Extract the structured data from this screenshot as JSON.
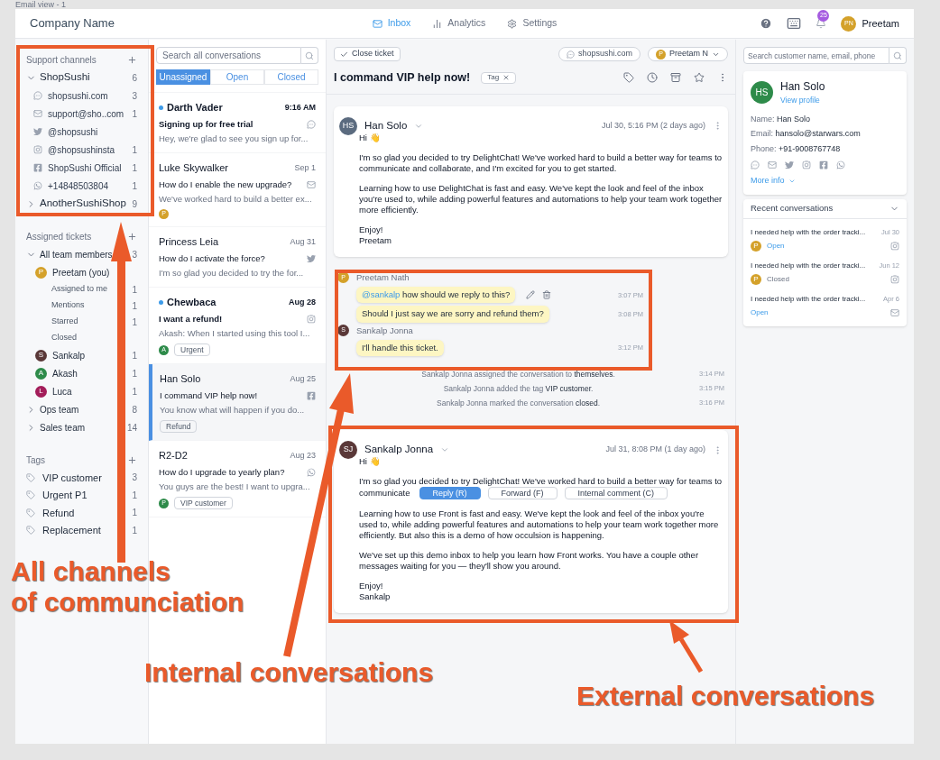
{
  "page_caption": "Email view - 1",
  "header": {
    "company": "Company Name",
    "nav": [
      {
        "label": "Inbox",
        "selected": true
      },
      {
        "label": "Analytics",
        "selected": false
      },
      {
        "label": "Settings",
        "selected": false
      }
    ],
    "notification_count": "25",
    "user": {
      "initials": "PN",
      "name": "Preetam"
    }
  },
  "sidebar": {
    "channels": {
      "title": "Support channels",
      "items": [
        {
          "label": "ShopSushi",
          "count": "6",
          "expanded": true,
          "children": [
            {
              "label": "shopsushi.com",
              "count": "3",
              "kind": "web"
            },
            {
              "label": "support@sho..com",
              "count": "1",
              "kind": "email"
            },
            {
              "label": "@shopsushi",
              "kind": "twitter"
            },
            {
              "label": "@shopsushinsta",
              "count": "1",
              "kind": "instagram"
            },
            {
              "label": "ShopSushi Official",
              "count": "1",
              "kind": "facebook"
            },
            {
              "label": "+14848503804",
              "count": "1",
              "kind": "whatsapp"
            }
          ]
        },
        {
          "label": "AnotherSushiShop",
          "count": "9",
          "expanded": false
        }
      ]
    },
    "assigned": {
      "title": "Assigned tickets",
      "items": [
        {
          "label": "All team members",
          "count": "3",
          "expanded": true,
          "children": [
            {
              "label": "Preetam (you)",
              "initial": "P",
              "color": "#d4a12a",
              "children": [
                {
                  "label": "Assigned to me",
                  "count": "1"
                },
                {
                  "label": "Mentions",
                  "count": "1"
                },
                {
                  "label": "Starred",
                  "count": "1"
                },
                {
                  "label": "Closed"
                }
              ]
            },
            {
              "label": "Sankalp",
              "initial": "S",
              "color": "#5a3838",
              "count": "1"
            },
            {
              "label": "Akash",
              "initial": "A",
              "color": "#2e8b4a",
              "count": "1"
            },
            {
              "label": "Luca",
              "initial": "L",
              "color": "#a31d5a",
              "count": "1"
            }
          ]
        },
        {
          "label": "Ops team",
          "count": "8",
          "expanded": false
        },
        {
          "label": "Sales team",
          "count": "14",
          "expanded": false
        }
      ]
    },
    "tags": {
      "title": "Tags",
      "items": [
        {
          "label": "VIP customer",
          "count": "3"
        },
        {
          "label": "Urgent P1",
          "count": "1"
        },
        {
          "label": "Refund",
          "count": "1"
        },
        {
          "label": "Replacement",
          "count": "1"
        }
      ]
    }
  },
  "conversations": {
    "search_placeholder": "Search all conversations",
    "filters": [
      {
        "label": "Unassigned",
        "selected": true
      },
      {
        "label": "Open",
        "selected": false
      },
      {
        "label": "Closed",
        "selected": false
      }
    ],
    "items": [
      {
        "name": "Darth Vader",
        "unread": true,
        "selected": false,
        "time": "9:16 AM",
        "subject": "Signing up for free trial",
        "preview": "Hey, we're glad to see you sign up for...",
        "kind": "web"
      },
      {
        "name": "Luke Skywalker",
        "unread": false,
        "selected": false,
        "time": "Sep 1",
        "subject": "How do I enable the new upgrade?",
        "preview": "We've worked hard to build a better ex...",
        "kind": "email",
        "assignee": {
          "initial": "P",
          "color": "#d4a12a"
        }
      },
      {
        "name": "Princess Leia",
        "unread": false,
        "selected": false,
        "time": "Aug 31",
        "subject": "How do I activate the force?",
        "preview": "I'm so glad you decided to try the for...",
        "kind": "twitter"
      },
      {
        "name": "Chewbaca",
        "unread": true,
        "selected": false,
        "time": "Aug 28",
        "subject": "I want a refund!",
        "preview": "Akash: When I started using this tool I...",
        "kind": "instagram",
        "assignee": {
          "initial": "A",
          "color": "#2e8b4a"
        },
        "tag": "Urgent"
      },
      {
        "name": "Han Solo",
        "unread": false,
        "selected": true,
        "time": "Aug 25",
        "subject": "I command VIP help now!",
        "preview": "You know what will happen if you do...",
        "kind": "facebook",
        "tag": "Refund"
      },
      {
        "name": "R2-D2",
        "unread": false,
        "selected": false,
        "time": "Aug 23",
        "subject": "How do I upgrade to yearly plan?",
        "preview": "You guys are the best! I want to upgra...",
        "kind": "whatsapp",
        "assignee": {
          "initial": "P",
          "color": "#2e8b4a"
        },
        "tag": "VIP customer"
      }
    ]
  },
  "ticket": {
    "close_button": "Close ticket",
    "channel": "shopsushi.com",
    "assignee": {
      "initial": "P",
      "name": "Preetam N"
    },
    "title": "I command VIP help now!",
    "tag_button": "Tag",
    "thread": [
      {
        "kind": "email",
        "initials": "HS",
        "color": "#5b6b7f",
        "author": "Han Solo",
        "time": "Jul 30, 5:16 PM (2 days ago)",
        "paragraphs": [
          "Hi 👋",
          "I'm so glad you decided to try DelightChat! We've worked hard to build a better way for teams to communicate and collaborate, and I'm excited for you to get started.",
          "Learning how to use DelightChat is fast and easy. We've kept the look and feel of the inbox you're used to, while adding powerful features and automations to help your team work together more efficiently.",
          "Enjoy!\nPreetam"
        ]
      },
      {
        "kind": "notes",
        "groups": [
          {
            "initial": "P",
            "color": "#d4a12a",
            "author": "Preetam Nath",
            "bubbles": [
              {
                "mention": "@sankalp",
                "text": " how should we reply to this?",
                "time": "3:07 PM",
                "editable": true
              },
              {
                "text": "Should I just say we are sorry and refund them?",
                "time": "3:08 PM",
                "editable": false
              }
            ]
          },
          {
            "initial": "S",
            "color": "#5a3838",
            "author": "Sankalp Jonna",
            "bubbles": [
              {
                "text": "I'll handle this ticket.",
                "time": "3:12 PM",
                "editable": false
              }
            ]
          }
        ]
      },
      {
        "kind": "event",
        "text": "Sankalp Jonna assigned the conversation to **themselves**.",
        "time": "3:14 PM"
      },
      {
        "kind": "event",
        "text": "Sankalp Jonna added the tag **VIP customer**.",
        "time": "3:15 PM"
      },
      {
        "kind": "event",
        "text": "Sankalp Jonna marked the conversation **closed**.",
        "time": "3:16 PM"
      },
      {
        "kind": "email",
        "initials": "SJ",
        "color": "#5a3838",
        "author": "Sankalp Jonna",
        "time": "Jul 31, 8:08 PM (1 day ago)",
        "paragraphs": [
          "Hi 👋",
          "I'm so glad you decided to try DelightChat! We've worked hard to build a better way for teams to",
          "Learning how to use Front is fast and easy. We've kept the look and feel of the inbox you're used to, while adding powerful features and automations to help your team work together more efficiently. But also this is a demo of how occulsion is happening.",
          "We've set up this demo inbox to help you learn how Front works. You have a couple other messages waiting for you — they'll show you around.",
          "Enjoy!\nSankalp"
        ],
        "occluded_line": "communicate",
        "reply_actions": [
          {
            "label": "Reply (R)",
            "selected": true
          },
          {
            "label": "Forward (F)",
            "selected": false
          },
          {
            "label": "Internal comment (C)",
            "selected": false
          }
        ]
      }
    ]
  },
  "customer": {
    "search_placeholder": "Search customer name, email, phone",
    "initials": "HS",
    "color": "#2e8b4a",
    "name": "Han Solo",
    "link": "View profile",
    "fields": [
      {
        "label": "Name:",
        "value": "Han Solo"
      },
      {
        "label": "Email:",
        "value": "hansolo@starwars.com"
      },
      {
        "label": "Phone:",
        "value": "+91-9008767748"
      }
    ],
    "more": "More info",
    "recent": {
      "title": "Recent conversations",
      "items": [
        {
          "subject": "I needed help with the order tracki...",
          "date": "Jul 30",
          "status": "Open",
          "open": true,
          "assignee": {
            "initial": "P",
            "color": "#d4a12a"
          },
          "kind": "instagram"
        },
        {
          "subject": "I needed help with the order tracki...",
          "date": "Jun 12",
          "status": "Closed",
          "open": false,
          "assignee": {
            "initial": "P",
            "color": "#d4a12a"
          },
          "kind": "instagram"
        },
        {
          "subject": "I needed help with the order tracki...",
          "date": "Apr 6",
          "status": "Open",
          "open": true,
          "kind": "email"
        }
      ]
    }
  },
  "annotations": [
    {
      "text": "All channels\nof communciation"
    },
    {
      "text": "Internal conversations"
    },
    {
      "text": "External conversations"
    }
  ]
}
